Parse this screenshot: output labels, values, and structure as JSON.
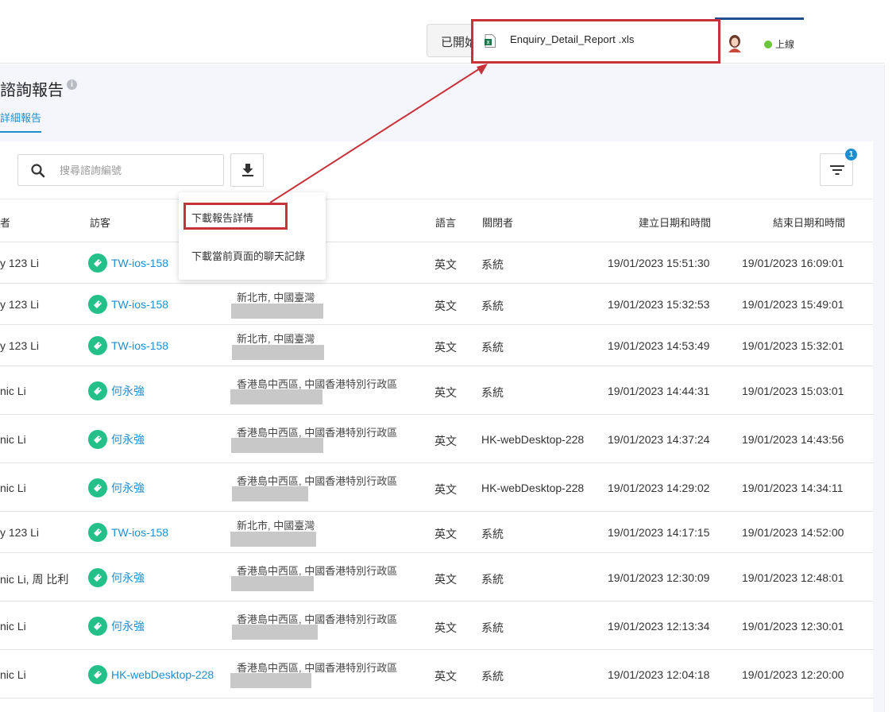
{
  "header": {
    "open_button_label": "已開始",
    "download_file_name": "Enquiry_Detail_Report .xls",
    "status": "上線"
  },
  "page": {
    "title": "諮詢報告",
    "tab": "詳細報告"
  },
  "toolbar": {
    "search_placeholder": "搜尋諮詢編號",
    "filter_badge": "1"
  },
  "download_menu": {
    "items": [
      "下載報告詳情",
      "下載當前頁面的聊天記錄"
    ]
  },
  "table": {
    "headers": {
      "agent": "者",
      "visitor": "訪客",
      "language": "語言",
      "closer": "關閉者",
      "created": "建立日期和時間",
      "ended": "結束日期和時間"
    },
    "rows": [
      {
        "agent": "y 123 Li",
        "visitor": "TW-ios-158",
        "location": "",
        "language": "英文",
        "closer": "系統",
        "created": "19/01/2023  15:51:30",
        "ended": "19/01/2023  16:09:01"
      },
      {
        "agent": "y 123 Li",
        "visitor": "TW-ios-158",
        "location": "新北市, 中國臺灣",
        "language": "英文",
        "closer": "系統",
        "created": "19/01/2023  15:32:53",
        "ended": "19/01/2023  15:49:01"
      },
      {
        "agent": "y 123 Li",
        "visitor": "TW-ios-158",
        "location": "新北市, 中國臺灣",
        "language": "英文",
        "closer": "系統",
        "created": "19/01/2023  14:53:49",
        "ended": "19/01/2023  15:32:01"
      },
      {
        "agent": "nic Li",
        "visitor": "何永強",
        "location": "香港島中西區, 中國香港特別行政區",
        "language": "英文",
        "closer": "系統",
        "created": "19/01/2023  14:44:31",
        "ended": "19/01/2023  15:03:01"
      },
      {
        "agent": "nic Li",
        "visitor": "何永強",
        "location": "香港島中西區, 中國香港特別行政區",
        "language": "英文",
        "closer": "HK-webDesktop-228",
        "created": "19/01/2023  14:37:24",
        "ended": "19/01/2023  14:43:56"
      },
      {
        "agent": "nic Li",
        "visitor": "何永強",
        "location": "香港島中西區, 中國香港特別行政區",
        "language": "英文",
        "closer": "HK-webDesktop-228",
        "created": "19/01/2023  14:29:02",
        "ended": "19/01/2023  14:34:11"
      },
      {
        "agent": "y 123 Li",
        "visitor": "TW-ios-158",
        "location": "新北市, 中國臺灣",
        "language": "英文",
        "closer": "系統",
        "created": "19/01/2023  14:17:15",
        "ended": "19/01/2023  14:52:00"
      },
      {
        "agent": "nic Li, 周 比利",
        "visitor": "何永強",
        "location": "香港島中西區, 中國香港特別行政區",
        "language": "英文",
        "closer": "系統",
        "created": "19/01/2023  12:30:09",
        "ended": "19/01/2023  12:48:01"
      },
      {
        "agent": "nic Li",
        "visitor": "何永強",
        "location": "香港島中西區, 中國香港特別行政區",
        "language": "英文",
        "closer": "系統",
        "created": "19/01/2023  12:13:34",
        "ended": "19/01/2023  12:30:01"
      },
      {
        "agent": "nic Li",
        "visitor": "HK-webDesktop-228",
        "location": "香港島中西區, 中國香港特別行政區",
        "language": "英文",
        "closer": "系統",
        "created": "19/01/2023  12:04:18",
        "ended": "19/01/2023  12:20:00"
      }
    ]
  },
  "colors": {
    "accent": "#1d8fd1",
    "visitor_icon": "#23c08a",
    "annotation_red": "#c8323a",
    "online": "#6cc63a"
  },
  "icons": [
    "search-icon",
    "download-icon",
    "filter-icon",
    "info-icon",
    "excel-file-icon",
    "avatar",
    "visitor-tag-icon"
  ]
}
